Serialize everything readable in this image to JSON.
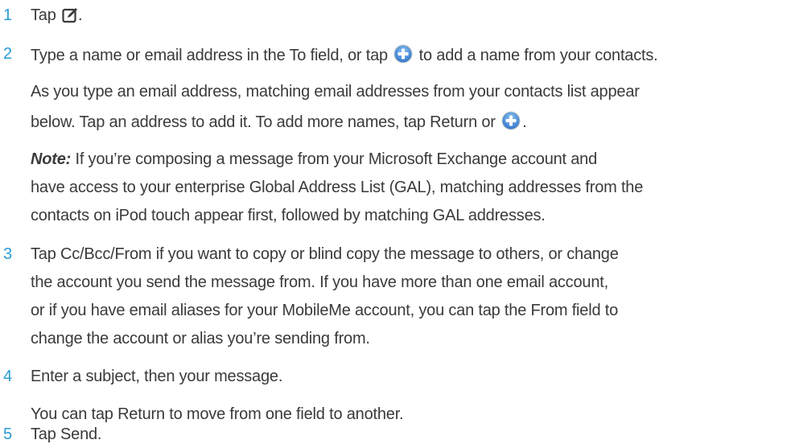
{
  "steps": [
    {
      "number": "1",
      "text_before": "Tap",
      "icon": "compose-icon",
      "text_after": "."
    },
    {
      "number": "2",
      "text_before": "Type a name or email address in the To field, or tap",
      "icon": "add-contact-plus-icon",
      "text_after": "to add a name from your contacts.",
      "para1_line1": "As you type an email address, matching email addresses from your contacts list appear",
      "para1_line2_before": "below. Tap an address to add it. To add more names, tap Return or",
      "para1_line2_icon": "add-contact-plus-icon",
      "para1_line2_after": ".",
      "note_label": "Note:",
      "note_line1": "If you’re composing a message from your Microsoft Exchange account and",
      "note_line2": "have access to your enterprise Global Address List (GAL), matching addresses from the",
      "note_line3": "contacts on iPod touch appear first, followed by matching GAL addresses."
    },
    {
      "number": "3",
      "line1": "Tap Cc/Bcc/From if you want to copy or blind copy the message to others, or change",
      "line2": "the account you send the message from. If you have more than one email account,",
      "line3": "or if you have email aliases for your MobileMe account, you can tap the From field to",
      "line4": "change the account or alias you’re sending from."
    },
    {
      "number": "4",
      "line1": "Enter a subject, then your message.",
      "para1": "You can tap Return to move from one field to another."
    },
    {
      "number": "5",
      "line1": "Tap Send."
    }
  ],
  "colors": {
    "step_number": "#2a9bd4",
    "body_text": "#3a3a3a",
    "plus_icon": "#4a8fd8"
  }
}
